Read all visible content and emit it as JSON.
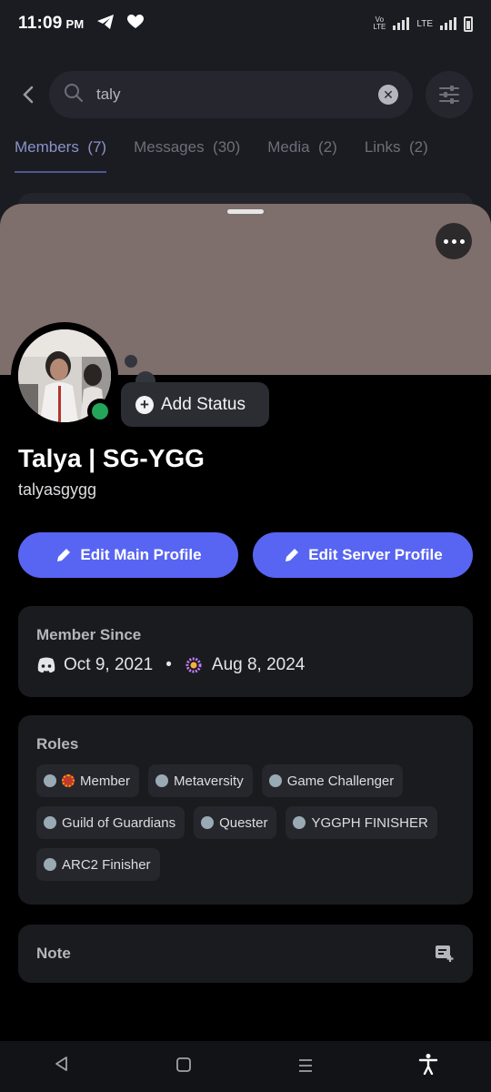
{
  "status_bar": {
    "time": "11:09",
    "ampm": "PM",
    "network_label": "LTE",
    "icons": [
      "telegram-icon",
      "heart-icon",
      "volte-icon",
      "signal-icon",
      "battery-icon"
    ]
  },
  "search": {
    "query": "taly",
    "placeholder": "Search"
  },
  "tabs": [
    {
      "label": "Members",
      "count": "(7)",
      "active": true
    },
    {
      "label": "Messages",
      "count": "(30)",
      "active": false
    },
    {
      "label": "Media",
      "count": "(2)",
      "active": false
    },
    {
      "label": "Links",
      "count": "(2)",
      "active": false
    }
  ],
  "profile": {
    "banner_color": "#7e6f6c",
    "display_name": "Talya | SG-YGG",
    "username": "talyasgygg",
    "status_button": "Add Status",
    "online_color": "#23a55a"
  },
  "actions": {
    "edit_main": "Edit Main Profile",
    "edit_server": "Edit Server Profile",
    "accent": "#5865f2"
  },
  "member_since": {
    "title": "Member Since",
    "discord_date": "Oct 9, 2021",
    "separator": "•",
    "server_date": "Aug 8, 2024"
  },
  "roles": {
    "title": "Roles",
    "items": [
      {
        "label": "Member",
        "badge": true
      },
      {
        "label": "Metaversity",
        "badge": false
      },
      {
        "label": "Game Challenger",
        "badge": false
      },
      {
        "label": "Guild of Guardians",
        "badge": false
      },
      {
        "label": "Quester",
        "badge": false
      },
      {
        "label": "YGGPH FINISHER",
        "badge": false
      },
      {
        "label": "ARC2 Finisher",
        "badge": false
      }
    ]
  },
  "note": {
    "title": "Note"
  }
}
